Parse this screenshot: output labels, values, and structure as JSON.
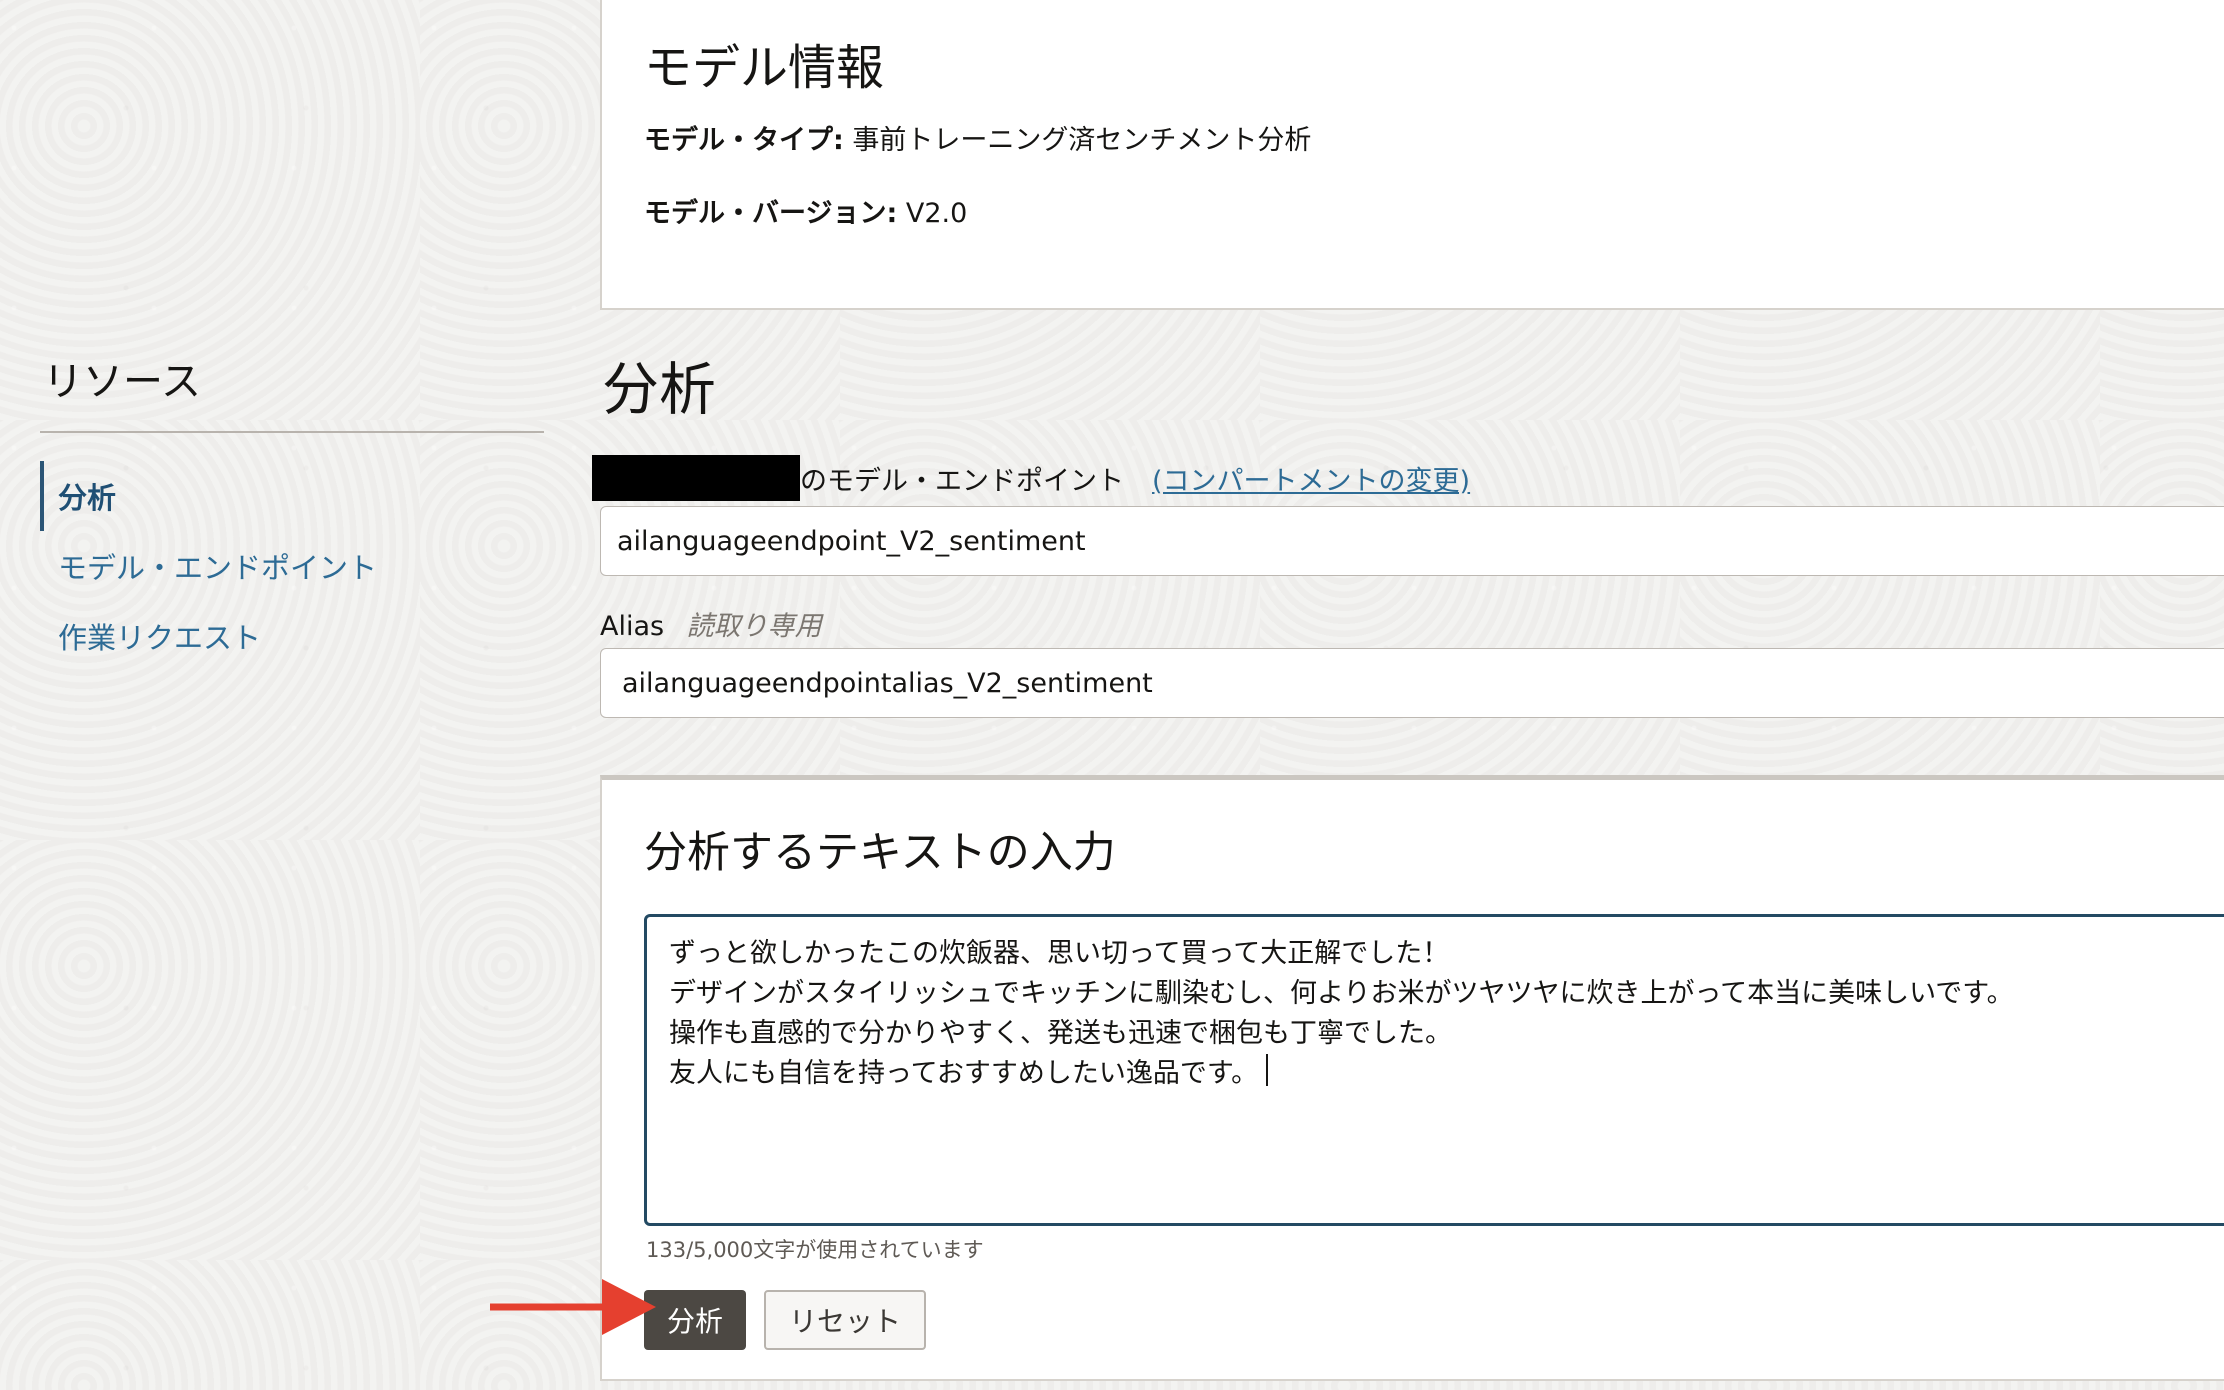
{
  "sidebar": {
    "title": "リソース",
    "items": [
      {
        "label": "分析",
        "active": true
      },
      {
        "label": "モデル・エンドポイント",
        "active": false
      },
      {
        "label": "作業リクエスト",
        "active": false
      }
    ]
  },
  "model_info": {
    "heading": "モデル情報",
    "type_label": "モデル・タイプ:",
    "type_value": "事前トレーニング済センチメント分析",
    "version_label": "モデル・バージョン:",
    "version_value": "V2.0"
  },
  "analysis": {
    "title": "分析",
    "endpoint_label": "のモデル・エンドポイント",
    "change_compartment_link": "(コンパートメントの変更)",
    "endpoint_value": "ailanguageendpoint_V2_sentiment",
    "alias_label": "Alias",
    "readonly_label": "読取り専用",
    "alias_value": "ailanguageendpointalias_V2_sentiment"
  },
  "text_input": {
    "heading": "分析するテキストの入力",
    "value": "ずっと欲しかったこの炊飯器、思い切って買って大正解でした！\nデザインがスタイリッシュでキッチンに馴染むし、何よりお米がツヤツヤに炊き上がって本当に美味しいです。\n操作も直感的で分かりやすく、発送も迅速で梱包も丁寧でした。\n友人にも自信を持っておすすめしたい逸品です。",
    "char_count": "133/5,000文字が使用されています",
    "analyze_button": "分析",
    "reset_button": "リセット"
  },
  "colors": {
    "accent": "#2d6b95",
    "primary_button": "#4c4843",
    "arrow": "#e5402f"
  }
}
